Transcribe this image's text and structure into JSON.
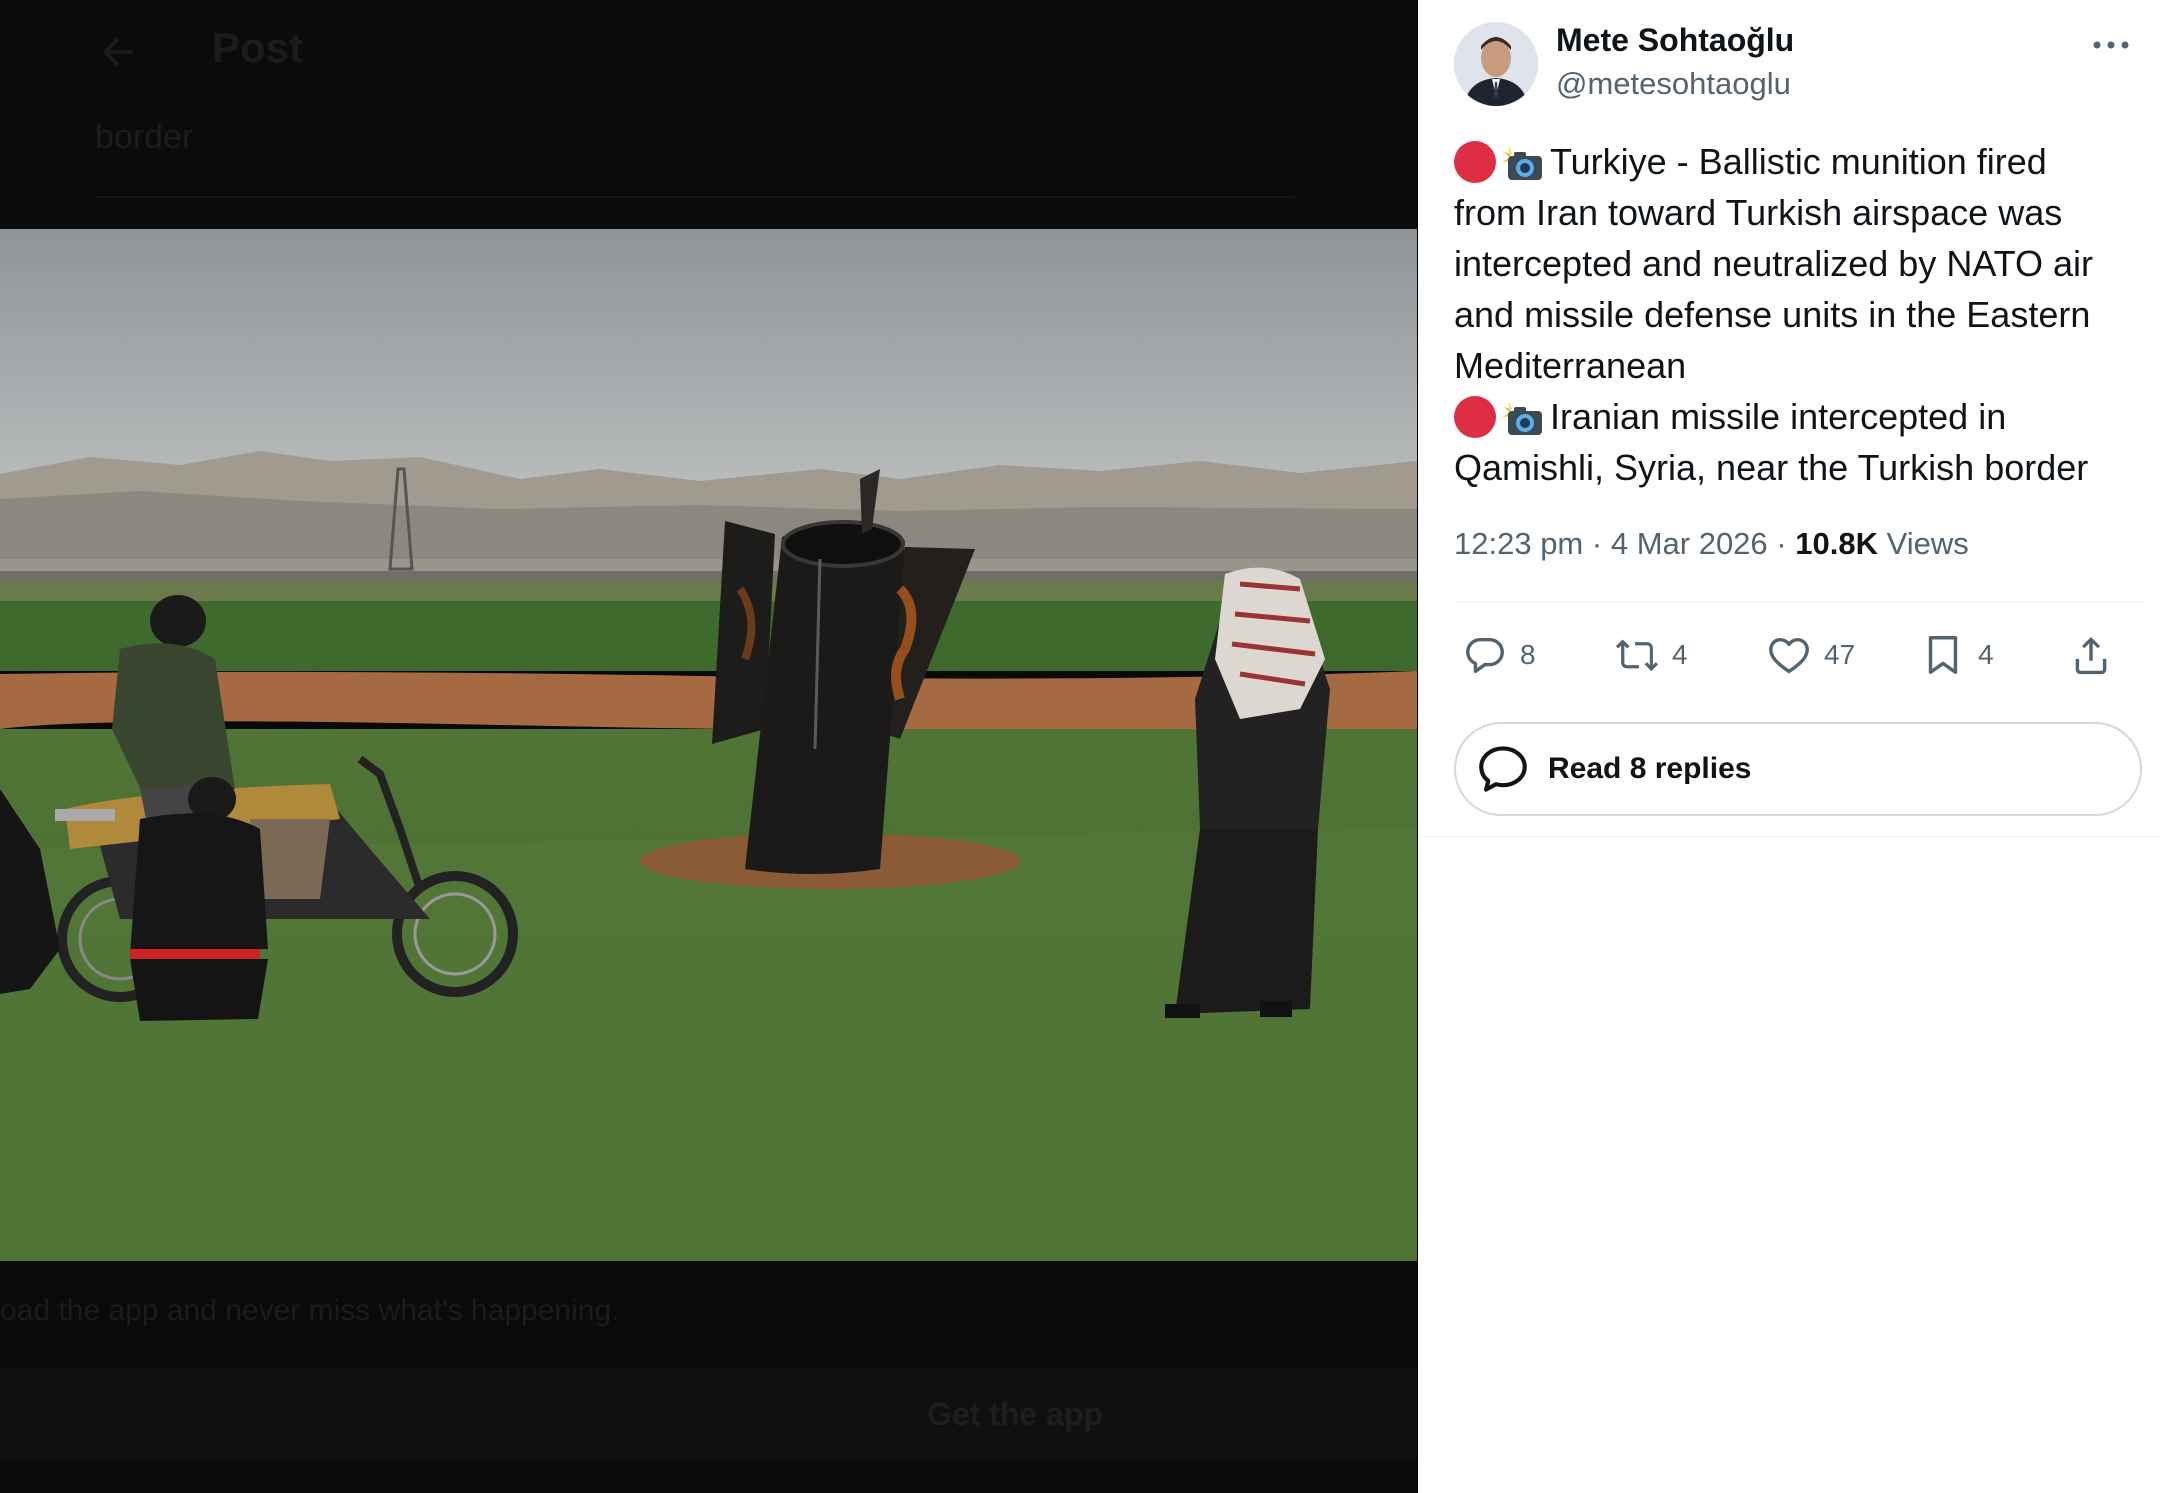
{
  "background": {
    "header_title": "Post",
    "snippet_text": "border",
    "banner_text": "oad the app and never miss what's happening.",
    "get_app_label": "Get the app"
  },
  "tweet": {
    "display_name": "Mete Sohtaoğlu",
    "handle": "@metesohtaoglu",
    "lines": [
      "Turkiye - Ballistic munition fired",
      "from Iran toward Turkish airspace was",
      "intercepted and neutralized by NATO air",
      "and missile defense units in the Eastern",
      "Mediterranean",
      "Iranian missile intercepted in",
      "Qamishli, Syria, near the Turkish border"
    ],
    "time": "12:23 pm",
    "date": "4 Mar 2026",
    "views_count": "10.8K",
    "views_label": "Views",
    "separator": "·"
  },
  "actions": {
    "replies": "8",
    "reposts": "4",
    "likes": "47",
    "bookmarks": "4"
  },
  "read_replies_label": "Read 8 replies",
  "icons": [
    "back-arrow-icon",
    "more-icon",
    "red-circle-icon",
    "camera-flash-icon",
    "reply-icon",
    "repost-icon",
    "like-icon",
    "bookmark-icon",
    "share-icon",
    "speech-bubble-icon"
  ],
  "colors": {
    "text": "#0f1419",
    "secondary": "#536471",
    "divider": "#eff3f4",
    "border": "#cfd9de",
    "red": "#dd2e44"
  }
}
